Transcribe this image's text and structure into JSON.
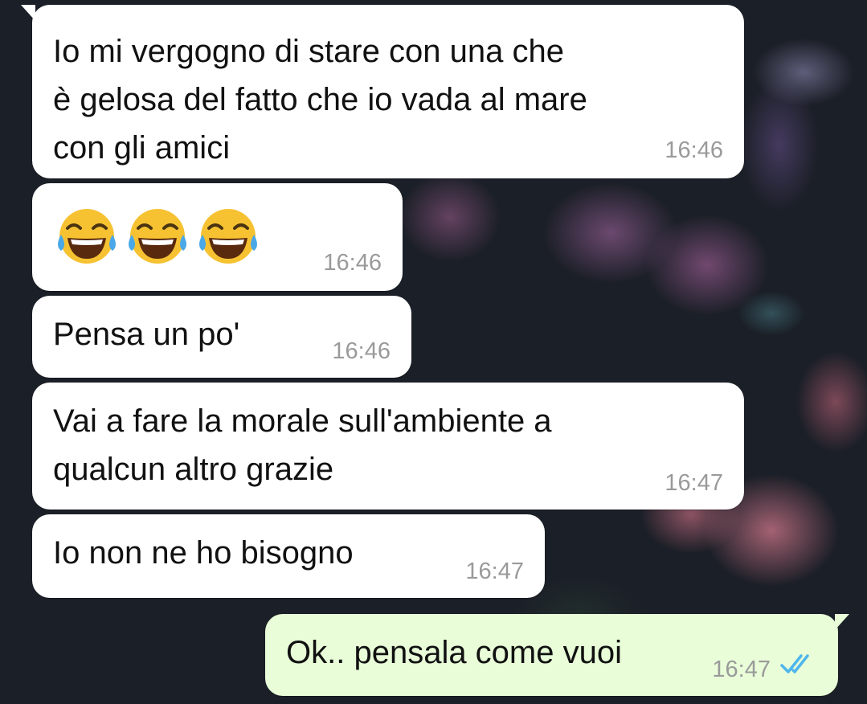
{
  "chat": {
    "messages": [
      {
        "direction": "in",
        "text": "Io mi vergogno di stare con una che\nè gelosa del fatto che io vada al mare\ncon gli amici",
        "time": "16:46"
      },
      {
        "direction": "in",
        "emoji": [
          "face-with-tears-of-joy",
          "face-with-tears-of-joy",
          "face-with-tears-of-joy"
        ],
        "time": "16:46"
      },
      {
        "direction": "in",
        "text": "Pensa un po'",
        "time": "16:46"
      },
      {
        "direction": "in",
        "text": "Vai a fare la morale sull'ambiente a\nqualcun altro grazie",
        "time": "16:47"
      },
      {
        "direction": "in",
        "text": "Io non ne ho bisogno",
        "time": "16:47"
      },
      {
        "direction": "out",
        "text": "Ok.. pensala come vuoi",
        "time": "16:47",
        "status_icon": "double-check-read-icon"
      }
    ]
  },
  "colors": {
    "incoming_bubble": "#ffffff",
    "outgoing_bubble": "#e8fdd8",
    "read_check": "#4fb6ec",
    "timestamp": "#9a9a9a"
  }
}
